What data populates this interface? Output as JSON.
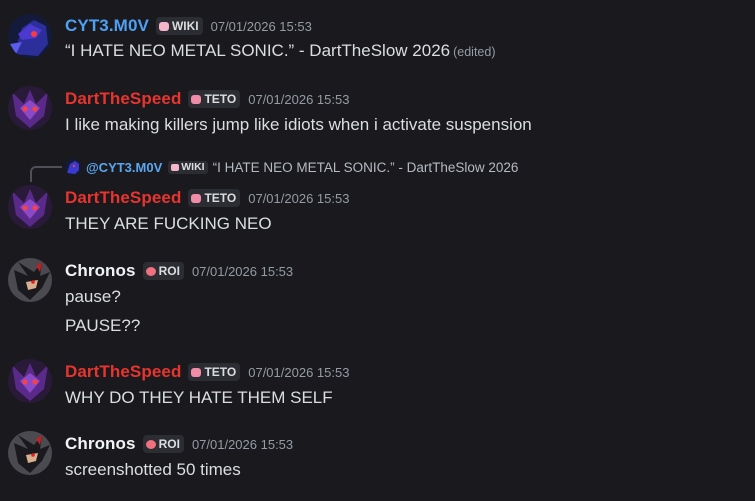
{
  "messages": [
    {
      "username": "CYT3.M0V",
      "tag": "WIKI",
      "timestamp": "07/01/2026 15:53",
      "lines": [
        "“I HATE NEO METAL SONIC.” - DartTheSlow 2026"
      ],
      "edited": "(edited)"
    },
    {
      "username": "DartTheSpeed",
      "tag": "TETO",
      "timestamp": "07/01/2026 15:53",
      "lines": [
        "I like making killers jump like idiots when i activate suspension"
      ]
    },
    {
      "reply": {
        "username": "@CYT3.M0V",
        "tag": "WIKI",
        "text": "“I HATE NEO METAL SONIC.” - DartTheSlow 2026"
      },
      "username": "DartTheSpeed",
      "tag": "TETO",
      "timestamp": "07/01/2026 15:53",
      "lines": [
        "THEY ARE FUCKING NEO"
      ]
    },
    {
      "username": "Chronos",
      "tag": "ROI",
      "timestamp": "07/01/2026 15:53",
      "lines": [
        "pause?",
        "PAUSE??"
      ]
    },
    {
      "username": "DartTheSpeed",
      "tag": "TETO",
      "timestamp": "07/01/2026 15:53",
      "lines": [
        "WHY DO THEY HATE THEM SELF"
      ]
    },
    {
      "username": "Chronos",
      "tag": "ROI",
      "timestamp": "07/01/2026 15:53",
      "lines": [
        "screenshotted 50 times"
      ]
    }
  ],
  "colors": {
    "background": "#1a1a1e",
    "cyt3_name": "#4ea0f5",
    "dart_name": "#e8342e",
    "chronos_name": "#f2f3f5",
    "timestamp": "#949ba4",
    "wiki_tag_icon": "#f4b6c8",
    "teto_tag_icon": "#f08ca8",
    "roi_tag_icon": "#f07080"
  }
}
